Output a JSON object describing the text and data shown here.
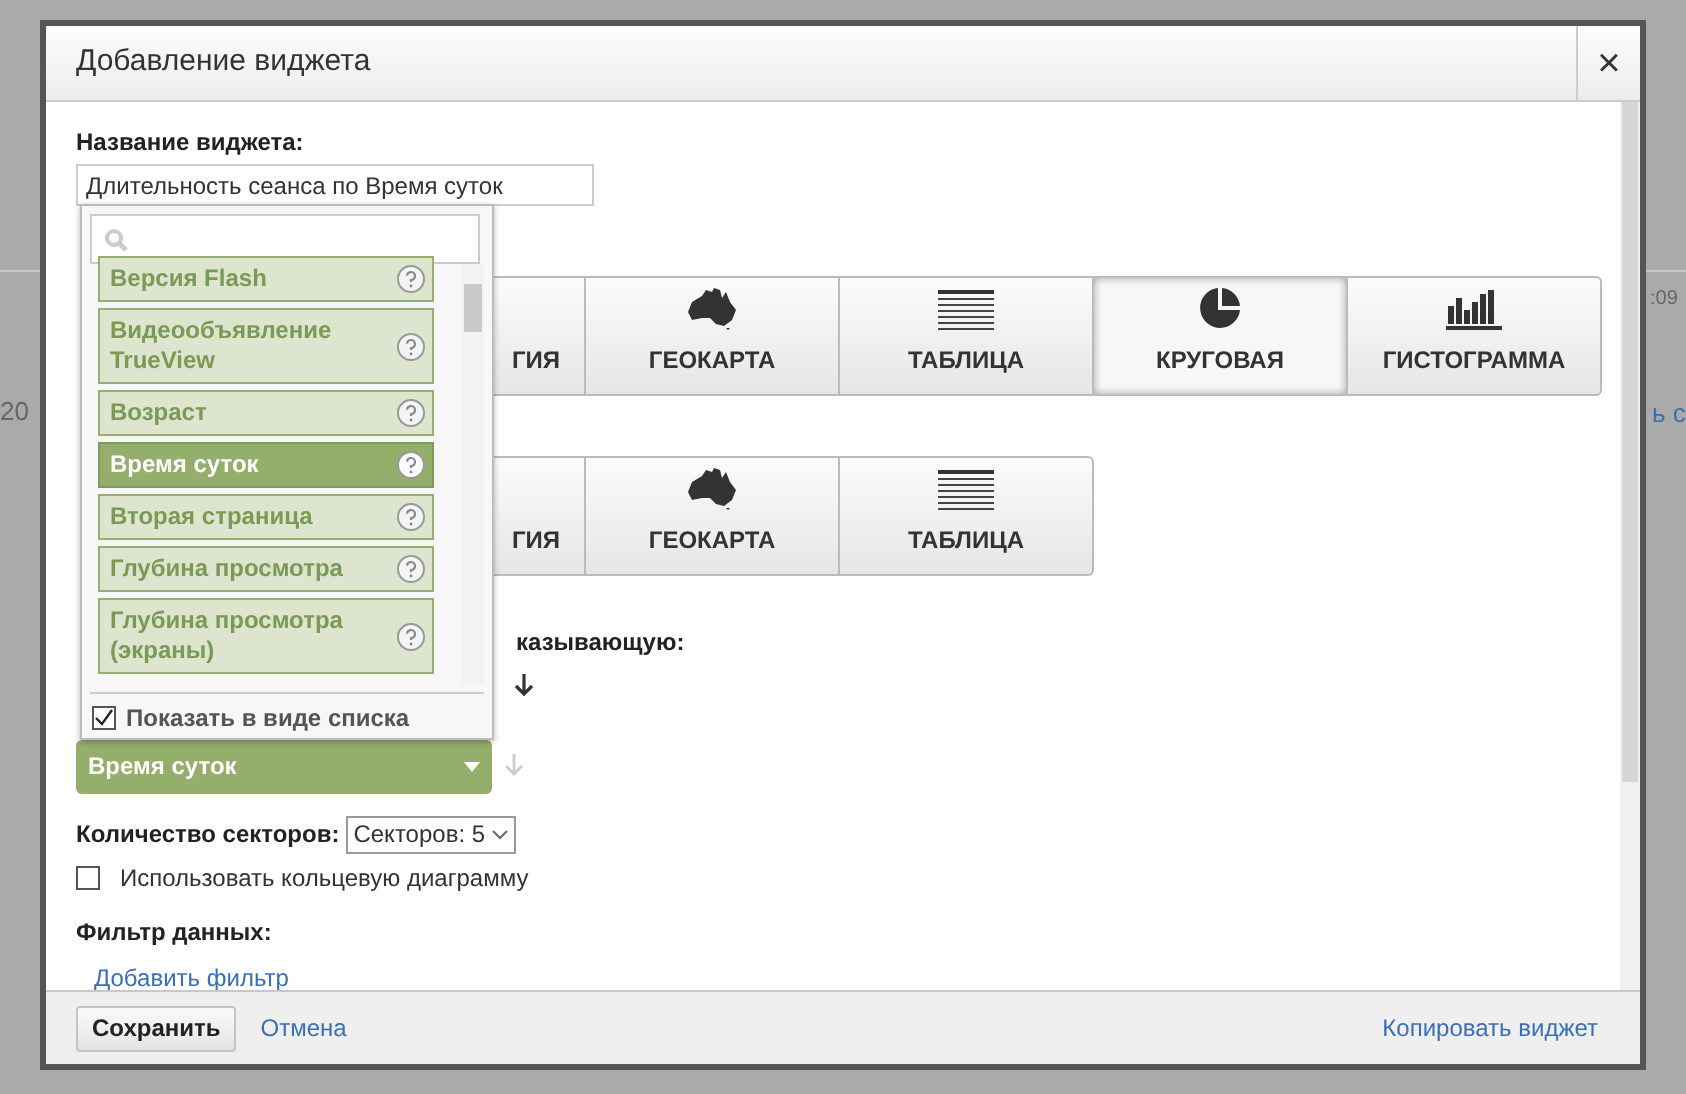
{
  "background": {
    "left_text": "20",
    "right_time": ":09",
    "right_link": "ь с"
  },
  "dialog": {
    "title": "Добавление виджета",
    "close": "×"
  },
  "name_field": {
    "label": "Название виджета:",
    "value": "Длительность сеанса по Время суток"
  },
  "chart_rows": [
    {
      "buttons": [
        {
          "kind": "covered",
          "label": "ГИЯ",
          "selected": false
        },
        {
          "kind": "map",
          "label": "ГЕОКАРТА",
          "selected": false
        },
        {
          "kind": "table",
          "label": "ТАБЛИЦА",
          "selected": false
        },
        {
          "kind": "pie",
          "label": "КРУГОВАЯ",
          "selected": true
        },
        {
          "kind": "bars",
          "label": "ГИСТОГРАММА",
          "selected": false
        }
      ]
    },
    {
      "buttons": [
        {
          "kind": "covered",
          "label": "ГИЯ",
          "selected": false
        },
        {
          "kind": "map",
          "label": "ГЕОКАРТА",
          "selected": false
        },
        {
          "kind": "table",
          "label": "ТАБЛИЦА",
          "selected": false
        }
      ]
    }
  ],
  "metric_label": "казывающую:",
  "dimension_select": {
    "value": "Время суток"
  },
  "sectors": {
    "label": "Количество секторов:",
    "value": "Секторов: 5"
  },
  "donut": {
    "label": "Использовать кольцевую диаграмму",
    "checked": false
  },
  "filter": {
    "label": "Фильтр данных:",
    "link": "Добавить фильтр"
  },
  "popup": {
    "items": [
      {
        "label": "Версия Flash",
        "selected": false
      },
      {
        "label": "Видеообъявление TrueView",
        "selected": false
      },
      {
        "label": "Возраст",
        "selected": false
      },
      {
        "label": "Время суток",
        "selected": true
      },
      {
        "label": "Вторая страница",
        "selected": false
      },
      {
        "label": "Глубина просмотра",
        "selected": false
      },
      {
        "label": "Глубина просмотра (экраны)",
        "selected": false
      }
    ],
    "list_view": {
      "label": "Показать в виде списка",
      "checked": true
    }
  },
  "footer": {
    "save": "Сохранить",
    "cancel": "Отмена",
    "copy": "Копировать виджет"
  }
}
